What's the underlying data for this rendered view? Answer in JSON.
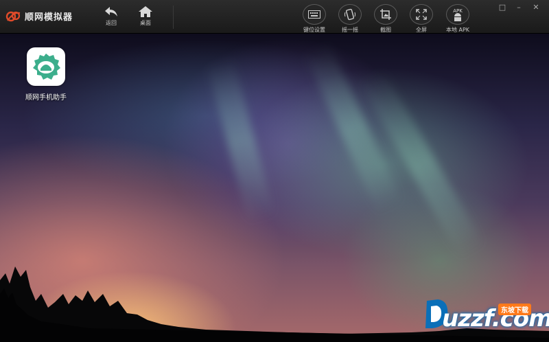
{
  "app": {
    "name": "顺网模拟器"
  },
  "nav": {
    "back_label": "返回",
    "home_label": "桌面"
  },
  "toolbar": {
    "keymap_label": "键位设置",
    "shake_label": "摇一摇",
    "screenshot_label": "截图",
    "fullscreen_label": "全屏",
    "local_apk_label": "本地 APK",
    "apk_tag": "APK"
  },
  "desktop": {
    "apps": [
      {
        "name": "顺网手机助手",
        "icon": "shunwang-assistant-icon"
      }
    ]
  },
  "watermark": {
    "letters": "uzzf",
    "suffix": ".com",
    "badge": "东坡下载"
  },
  "colors": {
    "titlebar": "#1f1f1f",
    "accent": "#e04b2a",
    "app_icon_green": "#3cae8c",
    "watermark_blue": "#0a6fb8",
    "watermark_orange": "#ff7a1a"
  }
}
